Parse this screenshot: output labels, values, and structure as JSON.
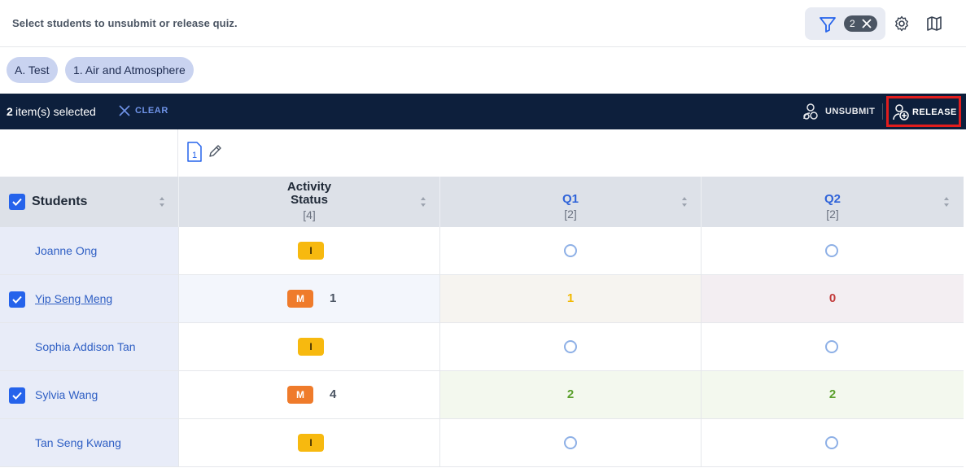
{
  "header": {
    "instruction": "Select students to unsubmit or release quiz.",
    "filter_count": "2"
  },
  "chips": [
    "A. Test",
    "1. Air and Atmosphere"
  ],
  "selection_bar": {
    "count": "2",
    "text": "item(s) selected",
    "clear_label": "CLEAR",
    "unsubmit_label": "UNSUBMIT",
    "release_label": "RELEASE"
  },
  "doc": {
    "number": "1"
  },
  "table": {
    "columns": {
      "students": "Students",
      "activity_line1": "Activity",
      "activity_line2": "Status",
      "activity_sub": "[4]",
      "q1": "Q1",
      "q1_sub": "[2]",
      "q2": "Q2",
      "q2_sub": "[2]"
    },
    "rows": [
      {
        "name": "Joanne Ong",
        "badge": "I",
        "count": "",
        "q1": "",
        "q2": ""
      },
      {
        "name": "Yip Seng Meng",
        "badge": "M",
        "count": "1",
        "q1": "1",
        "q2": "0"
      },
      {
        "name": "Sophia Addison Tan",
        "badge": "I",
        "count": "",
        "q1": "",
        "q2": ""
      },
      {
        "name": "Sylvia Wang",
        "badge": "M",
        "count": "4",
        "q1": "2",
        "q2": "2"
      },
      {
        "name": "Tan Seng Kwang",
        "badge": "I",
        "count": "",
        "q1": "",
        "q2": ""
      }
    ]
  },
  "colors": {
    "selection_bar": "#0d1f3c",
    "accent_blue": "#2563eb",
    "badge_incomplete": "#f7b90f",
    "badge_marked": "#ef7b2b",
    "score_partial": "#f2b800",
    "score_zero": "#c23b3b",
    "score_full": "#5aa02c",
    "release_highlight": "#e11d1d"
  }
}
